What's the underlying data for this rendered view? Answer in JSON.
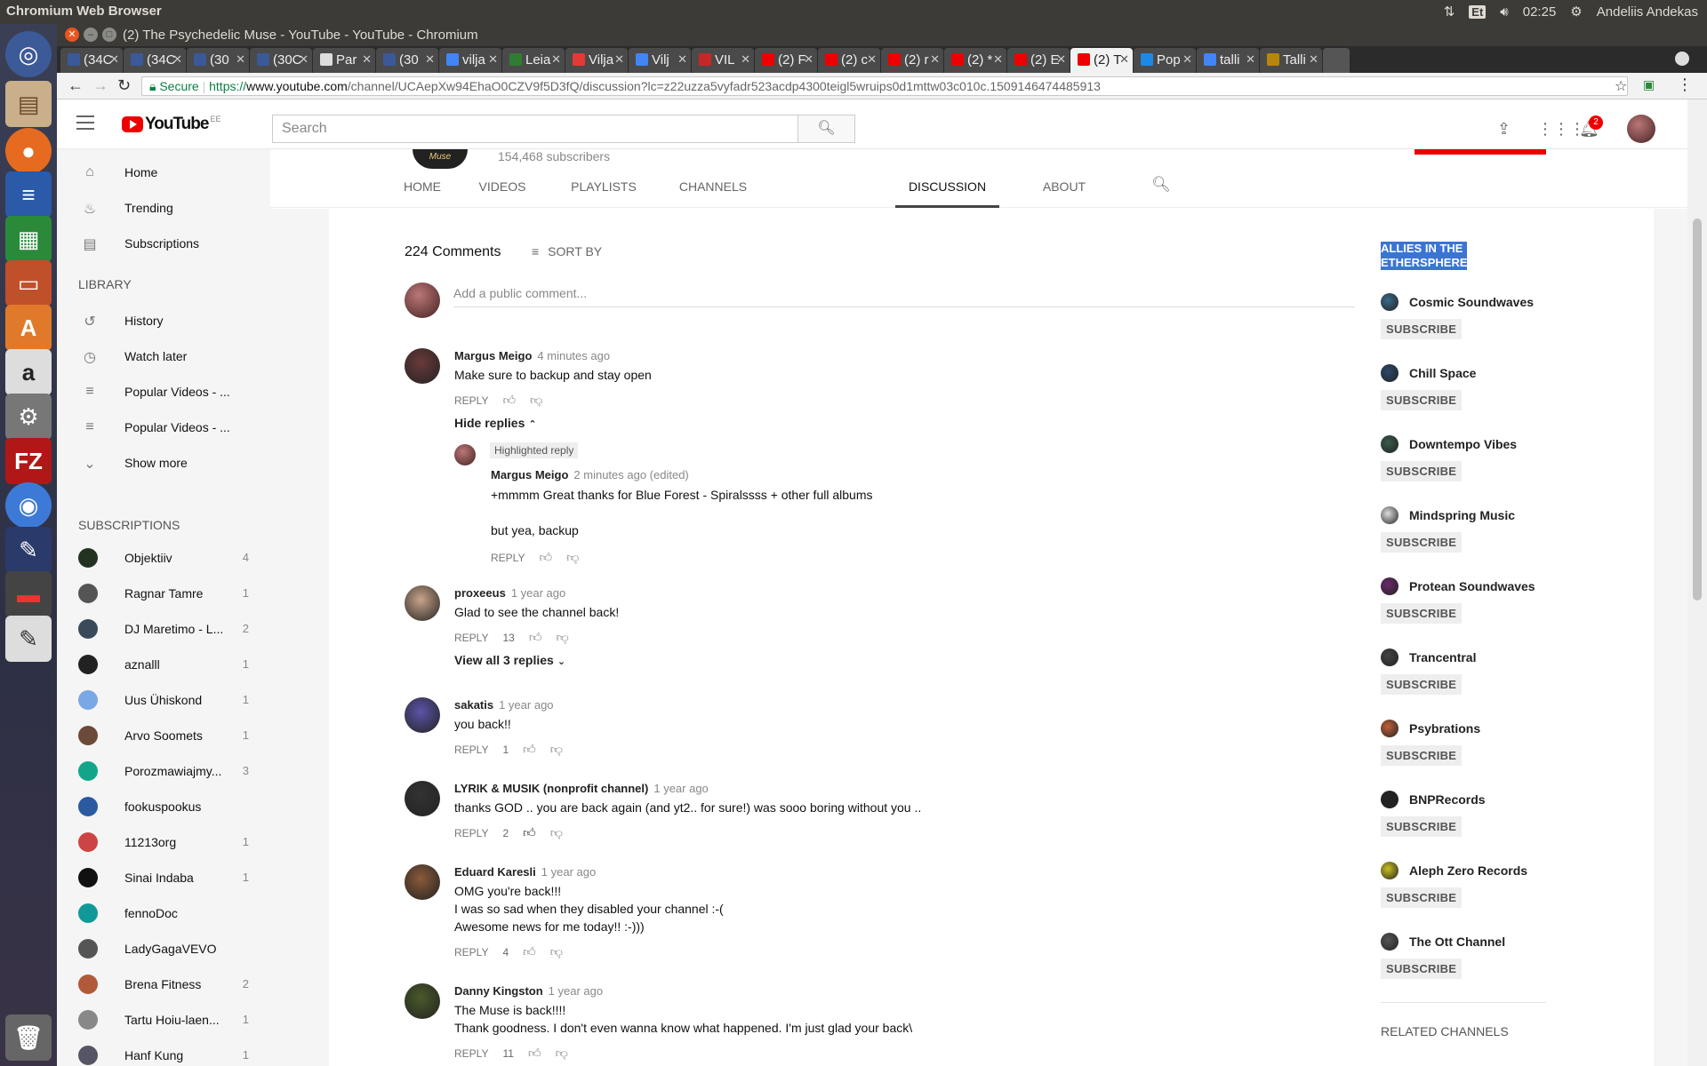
{
  "os": {
    "app_name": "Chromium Web Browser",
    "keyboard": "Et",
    "clock": "02:25",
    "user": "Andeliis Andekas",
    "icons": [
      "network-arrows-icon",
      "keyboard-icon",
      "volume-icon",
      "gear-icon"
    ]
  },
  "launcher": [
    "ubuntu-logo-icon",
    "files-icon",
    "firefox-icon",
    "writer-icon",
    "calc-icon",
    "impress-icon",
    "software-center-icon",
    "amazon-icon",
    "settings-icon",
    "filezilla-icon",
    "chromium-icon",
    "paint-icon",
    "red-app-icon",
    "text-editor-icon",
    "trash-icon"
  ],
  "window": {
    "title": "(2) The Psychedelic Muse - YouTube - YouTube - Chromium"
  },
  "tabs": [
    {
      "label": "(34C",
      "fav": "#3b5998"
    },
    {
      "label": "(34C",
      "fav": "#3b5998"
    },
    {
      "label": "(30",
      "fav": "#3b5998"
    },
    {
      "label": "(30C",
      "fav": "#3b5998"
    },
    {
      "label": "Par",
      "fav": "#ddd"
    },
    {
      "label": "(30",
      "fav": "#3b5998"
    },
    {
      "label": "vilja",
      "fav": "#4285f4"
    },
    {
      "label": "Leia",
      "fav": "#2e7d32"
    },
    {
      "label": "Vilja",
      "fav": "#e53935"
    },
    {
      "label": "Vilj",
      "fav": "#4285f4"
    },
    {
      "label": "VIL",
      "fav": "#c62828"
    },
    {
      "label": "(2) F",
      "fav": "#e00"
    },
    {
      "label": "(2) c",
      "fav": "#e00"
    },
    {
      "label": "(2) r",
      "fav": "#e00"
    },
    {
      "label": "(2) *",
      "fav": "#e00"
    },
    {
      "label": "(2) E",
      "fav": "#e00"
    },
    {
      "label": "(2) T",
      "fav": "#e00"
    },
    {
      "label": "Pop",
      "fav": "#1e88e5"
    },
    {
      "label": "talli",
      "fav": "#4285f4"
    },
    {
      "label": "Talli",
      "fav": "#b8860b"
    }
  ],
  "toolbar": {
    "secure": "Secure",
    "url_scheme": "https://",
    "url_domain": "www.youtube.com",
    "url_rest": "/channel/UCAepXw94EhaO0CZV9f5D3fQ/discussion?lc=z22uzza5vyfadr523acdp4300teigl5wruips0d1mttw03c010c.1509146474485913"
  },
  "masthead": {
    "logo": "YouTube",
    "country": "EE",
    "search_placeholder": "Search",
    "notifications": "2"
  },
  "sidebar": {
    "main": [
      {
        "label": "Home",
        "icon": "home-icon"
      },
      {
        "label": "Trending",
        "icon": "flame-icon"
      },
      {
        "label": "Subscriptions",
        "icon": "subscriptions-icon"
      }
    ],
    "library_title": "LIBRARY",
    "library": [
      {
        "label": "History",
        "icon": "history-icon"
      },
      {
        "label": "Watch later",
        "icon": "clock-icon"
      },
      {
        "label": "Popular Videos - ...",
        "icon": "playlist-icon"
      },
      {
        "label": "Popular Videos - ...",
        "icon": "playlist-icon"
      },
      {
        "label": "Show more",
        "icon": "chevron-down-icon"
      }
    ],
    "subs_title": "SUBSCRIPTIONS",
    "subscriptions": [
      {
        "label": "Objektiiv",
        "count": "4",
        "color": "#223322"
      },
      {
        "label": "Ragnar Tamre",
        "count": "1",
        "color": "#555"
      },
      {
        "label": "DJ Maretimo - L...",
        "count": "2",
        "color": "#3a4a5a"
      },
      {
        "label": "aznalll",
        "count": "1",
        "color": "#222"
      },
      {
        "label": "Uus Ühiskond",
        "count": "1",
        "color": "#7aa7e6"
      },
      {
        "label": "Arvo Soomets",
        "count": "1",
        "color": "#6b4a3a"
      },
      {
        "label": "Porozmawiajmy...",
        "count": "3",
        "color": "#12a58a"
      },
      {
        "label": "fookuspookus",
        "count": "",
        "color": "#2a5aa0"
      },
      {
        "label": "11213org",
        "count": "1",
        "color": "#c44"
      },
      {
        "label": "Sinai Indaba",
        "count": "1",
        "color": "#111"
      },
      {
        "label": "fennoDoc",
        "count": "",
        "color": "#199"
      },
      {
        "label": "LadyGagaVEVO",
        "count": "",
        "color": "#555"
      },
      {
        "label": "Brena Fitness",
        "count": "2",
        "color": "#b05a3a"
      },
      {
        "label": "Tartu Hoiu-laen...",
        "count": "1",
        "color": "#888"
      },
      {
        "label": "Hanf Kung",
        "count": "1",
        "color": "#556"
      }
    ]
  },
  "channel": {
    "subscribers": "154,468 subscribers",
    "logo_text": "Muse",
    "tabs": [
      "HOME",
      "VIDEOS",
      "PLAYLISTS",
      "CHANNELS",
      "DISCUSSION",
      "ABOUT"
    ],
    "active_tab": "DISCUSSION"
  },
  "discussion": {
    "count": "224 Comments",
    "sort": "SORT BY",
    "add_placeholder": "Add a public comment...",
    "reply_label": "REPLY",
    "comments": [
      {
        "author": "Margus Meigo",
        "time": "4 minutes ago",
        "lines": [
          "Make sure to backup and stay open"
        ],
        "likes": "",
        "toggle": "Hide replies",
        "color": "#6a3a3a"
      },
      {
        "author": "proxeeus",
        "time": "1 year ago",
        "lines": [
          "Glad to see the channel back!"
        ],
        "likes": "13",
        "toggle": "View all 3 replies",
        "color": "#c9a58a"
      },
      {
        "author": "sakatis",
        "time": "1 year ago",
        "lines": [
          "you back!!"
        ],
        "likes": "1",
        "color": "#5b54a8"
      },
      {
        "author": "LYRIK & MUSIK (nonprofit channel)",
        "time": "1 year ago",
        "lines": [
          "thanks GOD .. you are back again (and yt2.. for sure!) was sooo boring without you .."
        ],
        "likes": "2",
        "color": "#333"
      },
      {
        "author": "Eduard Karesli",
        "time": "1 year ago",
        "lines": [
          "OMG you're back!!!",
          "I was so sad when they disabled your channel :-(",
          "Awesome news for me today!! :-)))"
        ],
        "likes": "4",
        "color": "#8a5a3a"
      },
      {
        "author": "Danny Kingston",
        "time": "1 year ago",
        "lines": [
          "The Muse is back!!!!",
          "Thank goodness.  I don't even wanna know what happened. I'm just glad your back\\"
        ],
        "likes": "11",
        "color": "#4a5a2a"
      }
    ],
    "reply": {
      "badge": "Highlighted reply",
      "author": "Margus Meigo",
      "time": "2 minutes ago (edited)",
      "line1": "+mmmm Great thanks for Blue Forest - Spiralssss + other full albums",
      "line2": "but  yea, backup"
    }
  },
  "allies": {
    "title": "ALLIES IN THE ETHERSPHERE",
    "subscribe": "SUBSCRIBE",
    "items": [
      {
        "name": "Cosmic Soundwaves",
        "color": "#3a6a8a"
      },
      {
        "name": "Chill Space",
        "color": "#2a4a6a"
      },
      {
        "name": "Downtempo Vibes",
        "color": "#3a5a4a"
      },
      {
        "name": "Mindspring Music",
        "color": "#ddd"
      },
      {
        "name": "Protean Soundwaves",
        "color": "#6a2a6a"
      },
      {
        "name": "Trancentral",
        "color": "#444"
      },
      {
        "name": "Psybrations",
        "color": "#c0603a"
      },
      {
        "name": "BNPRecords",
        "color": "#222"
      },
      {
        "name": "Aleph Zero Records",
        "color": "#c8c020"
      },
      {
        "name": "The Ott Channel",
        "color": "#555"
      }
    ],
    "related": "RELATED CHANNELS"
  }
}
